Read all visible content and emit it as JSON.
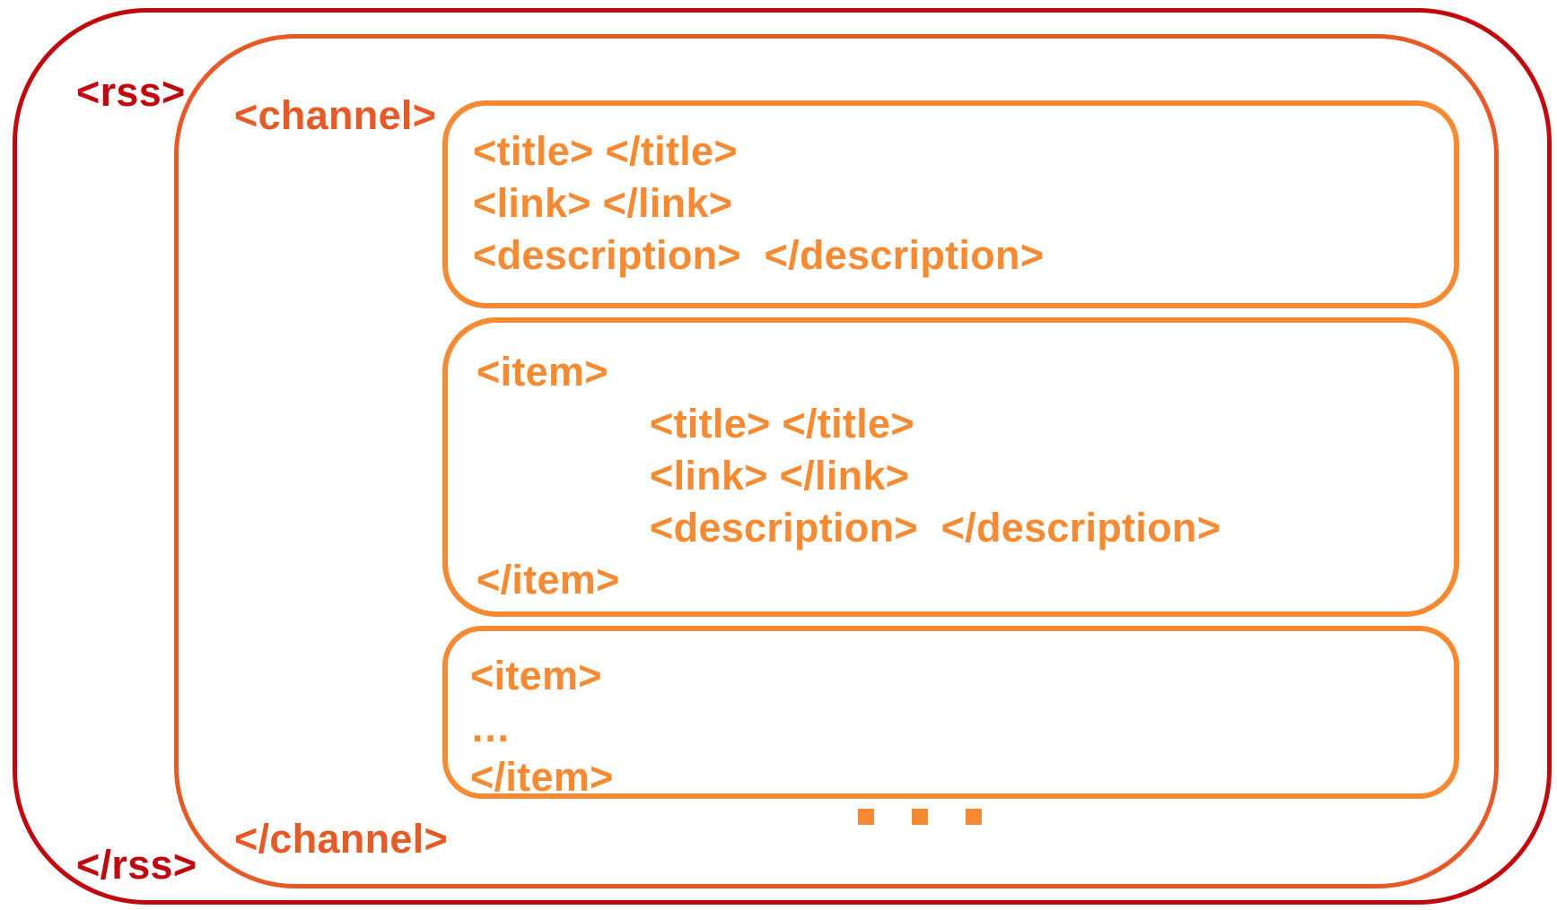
{
  "rss": {
    "open_tag": "<rss>",
    "close_tag": "</rss>"
  },
  "channel": {
    "open_tag": "<channel>",
    "close_tag": "</channel>",
    "meta": {
      "title": "<title> </title>",
      "link": "<link> </link>",
      "description": "<description>  </description>"
    },
    "items": [
      {
        "open_tag": "<item>",
        "title": "<title> </title>",
        "link": "<link> </link>",
        "description": "<description>  </description>",
        "close_tag": "</item>"
      },
      {
        "open_tag": "<item>",
        "ellipsis": "…",
        "close_tag": "</item>"
      }
    ],
    "more_items_marker": "continuation-dots"
  },
  "colors": {
    "rss": "#c0090f",
    "channel": "#e55a26",
    "inner": "#f58a32"
  }
}
